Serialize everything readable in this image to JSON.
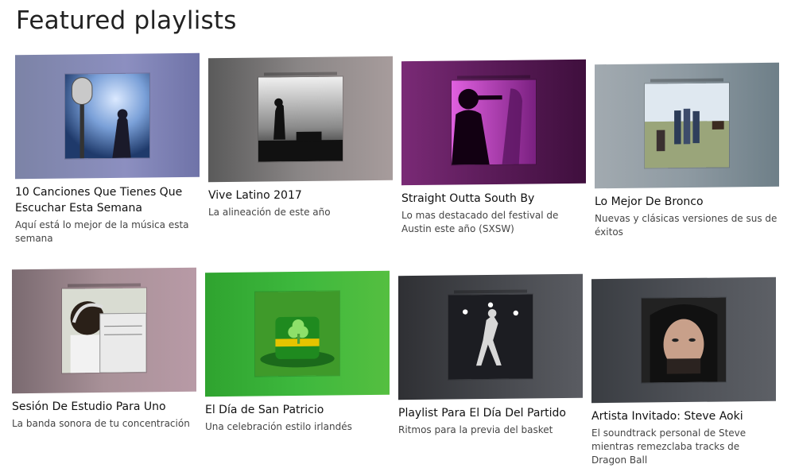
{
  "page": {
    "title": "Featured playlists"
  },
  "playlists": [
    {
      "title": "10 Canciones Que Tienes Que Escuchar Esta Semana",
      "desc": "Aquí está lo mejor de la música esta semana",
      "art": "microphone-concert-art"
    },
    {
      "title": "Vive Latino 2017",
      "desc": "La alineación de este año",
      "art": "concert-stage-art"
    },
    {
      "title": "Straight Outta South By",
      "desc": "Lo mas destacado del festival de Austin este año (SXSW)",
      "art": "singer-silhouette-art"
    },
    {
      "title": "Lo Mejor De Bronco",
      "desc": "Nuevas y clásicas versiones de sus de éxitos",
      "art": "band-photo-art"
    },
    {
      "title": "Sesión De Estudio Para Uno",
      "desc": "La banda sonora de tu concentración",
      "art": "girl-reading-art"
    },
    {
      "title": "El Día de San Patricio",
      "desc": "Una celebración estilo irlandés",
      "art": "shamrock-hat-art"
    },
    {
      "title": "Playlist Para El Día Del Partido",
      "desc": "Ritmos para la previa del basket",
      "art": "basketball-player-art"
    },
    {
      "title": "Artista Invitado: Steve Aoki",
      "desc": "El soundtrack personal de Steve mientras remezclaba tracks de Dragon Ball",
      "art": "steve-aoki-portrait-art"
    }
  ]
}
